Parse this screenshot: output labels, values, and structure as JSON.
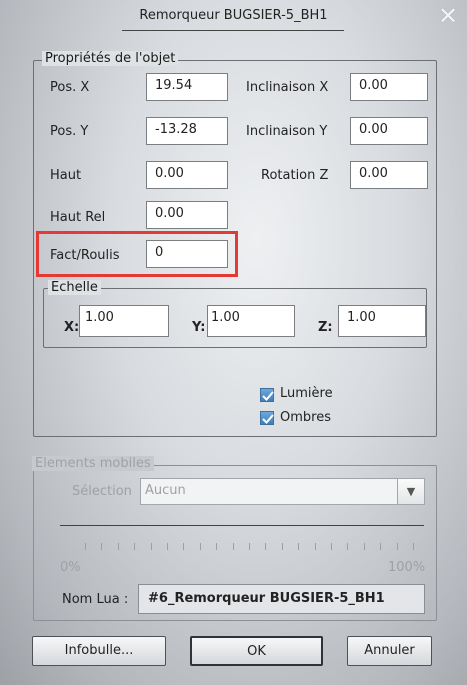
{
  "title": "Remorqueur BUGSIER-5_BH1",
  "props": {
    "legend": "Propriétés de l'objet",
    "pos_x_label": "Pos. X",
    "pos_x": "19.54",
    "pos_y_label": "Pos. Y",
    "pos_y": "-13.28",
    "haut_label": "Haut",
    "haut": "0.00",
    "haut_rel_label": "Haut Rel",
    "haut_rel": "0.00",
    "fact_label": "Fact/Roulis",
    "fact": "0",
    "incl_x_label": "Inclinaison X",
    "incl_x": "0.00",
    "incl_y_label": "Inclinaison Y",
    "incl_y": "0.00",
    "rot_z_label": "Rotation Z",
    "rot_z": "0.00"
  },
  "echelle": {
    "legend": "Echelle",
    "x_label": "X:",
    "x": "1.00",
    "y_label": "Y:",
    "y": "1.00",
    "z_label": "Z:",
    "z": "1.00"
  },
  "options": {
    "lumiere": "Lumière",
    "ombres": "Ombres",
    "lumiere_checked": true,
    "ombres_checked": true
  },
  "mobiles": {
    "legend": "Elements mobiles",
    "selection_label": "Sélection",
    "selection_value": "Aucun",
    "progress_percent": 0,
    "min_label": "0%",
    "max_label": "100%",
    "nom_lua_label": "Nom Lua :",
    "nom_lua": "#6_Remorqueur BUGSIER-5_BH1"
  },
  "buttons": {
    "infobulle": "Infobulle...",
    "ok": "OK",
    "annuler": "Annuler"
  },
  "colors": {
    "highlight": "#e53935",
    "checkbox": "#3d7fbf"
  }
}
